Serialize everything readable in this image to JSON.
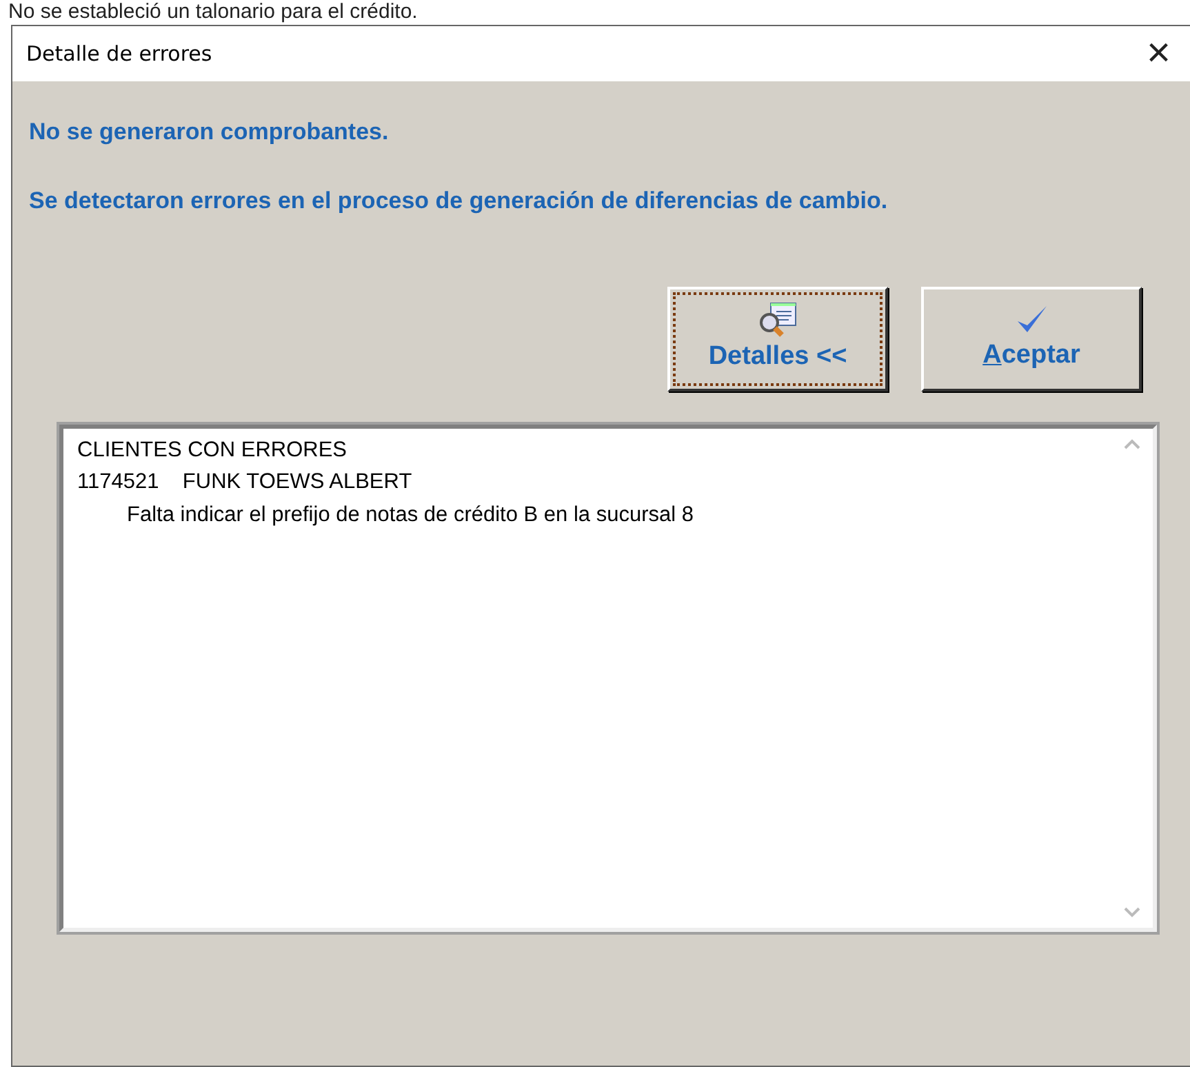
{
  "background_text": "No se estableció un talonario para el crédito.",
  "window": {
    "title": "Detalle de errores",
    "close": "×"
  },
  "messages": [
    "No se generaron comprobantes.",
    "Se detectaron errores en el proceso de generación de  diferencias de cambio."
  ],
  "buttons": [
    {
      "label": "Detalles <<",
      "kind": "details",
      "focused": true
    },
    {
      "label": "Aceptar",
      "kind": "accept",
      "focused": false,
      "underline_first": true
    }
  ],
  "details_lines": [
    {
      "text": "CLIENTES CON ERRORES",
      "indented": false
    },
    {
      "text": "1174521    FUNK TOEWS ALBERT",
      "indented": false
    },
    {
      "text": "Falta indicar el prefijo de notas de crédito B en la sucursal 8",
      "indented": true
    }
  ]
}
